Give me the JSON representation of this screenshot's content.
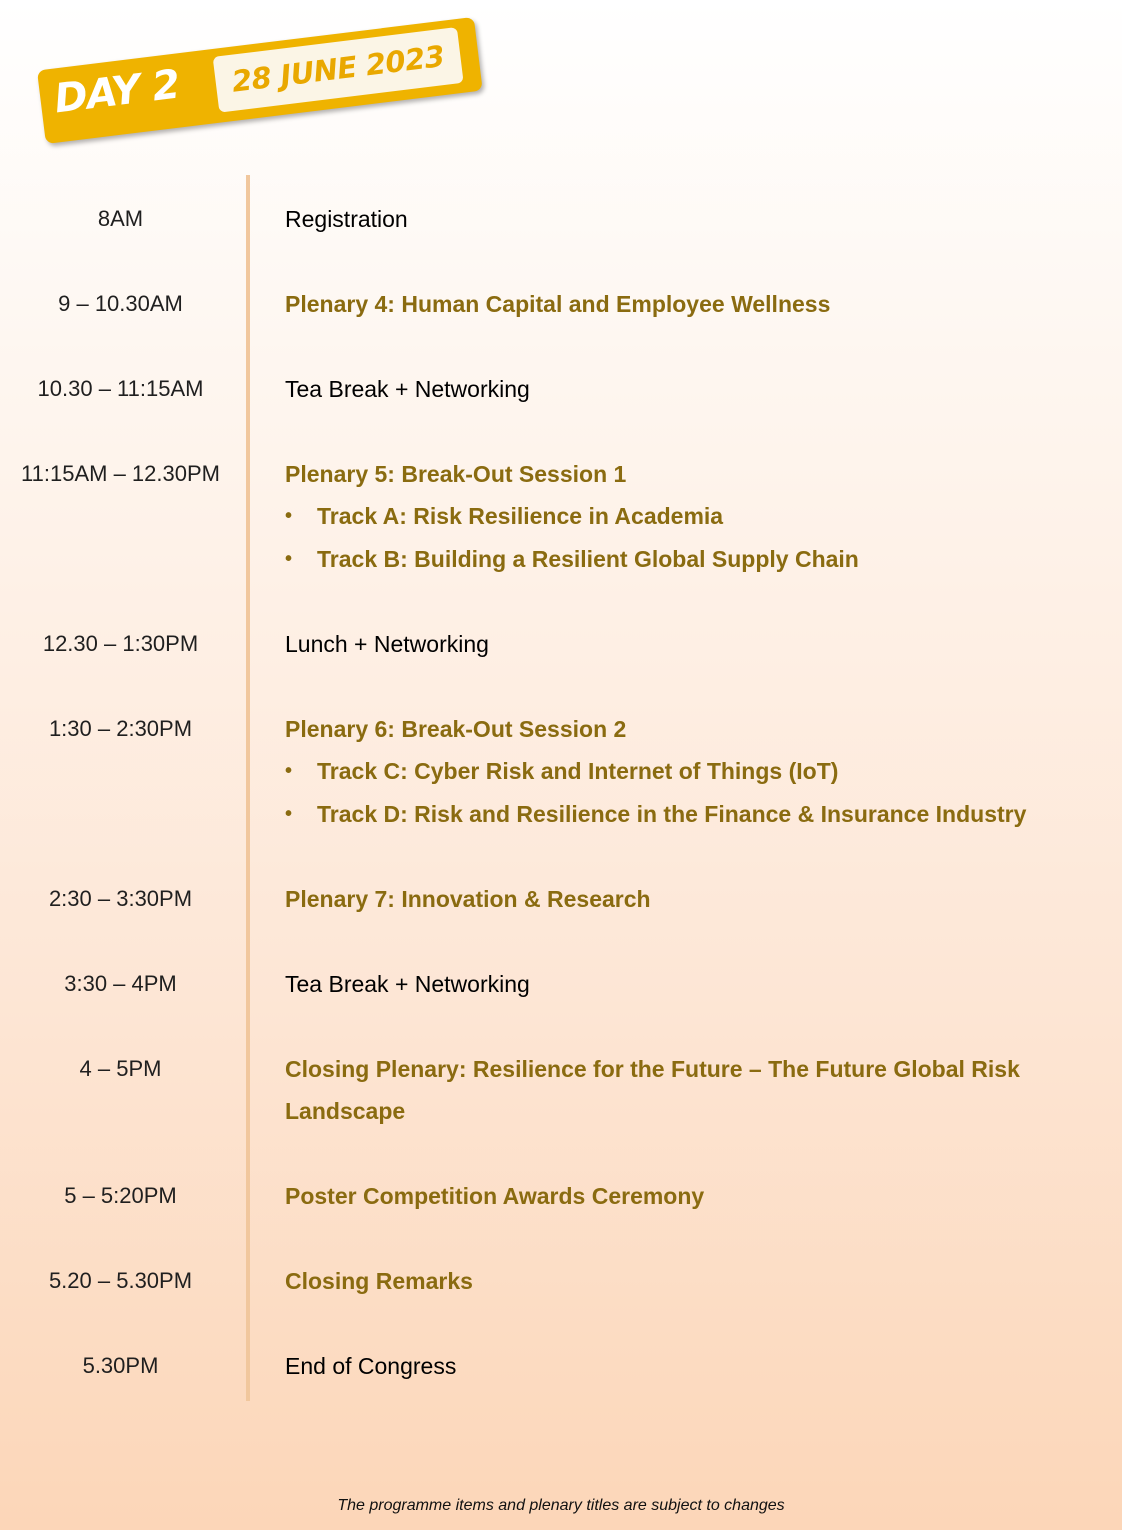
{
  "header": {
    "day": "DAY 2",
    "date": "28 JUNE 2023"
  },
  "agenda": [
    {
      "time": "8AM",
      "title": "Registration"
    },
    {
      "time": "9 – 10.30AM",
      "title": "Plenary 4: Human Capital and Employee Wellness"
    },
    {
      "time": "10.30 – 11:15AM",
      "title": "Tea Break + Networking"
    },
    {
      "time": "11:15AM – 12.30PM",
      "title": "Plenary 5: Break-Out Session 1",
      "tracks": [
        "Track A: Risk Resilience in Academia",
        "Track B: Building a Resilient Global Supply Chain"
      ]
    },
    {
      "time": "12.30 – 1:30PM",
      "title": "Lunch + Networking"
    },
    {
      "time": "1:30 – 2:30PM",
      "title": "Plenary 6: Break-Out Session 2",
      "tracks": [
        "Track C: Cyber Risk and Internet of Things (IoT)",
        "Track D: Risk and Resilience in the Finance & Insurance Industry"
      ]
    },
    {
      "time": "2:30 – 3:30PM",
      "title": "Plenary 7: Innovation & Research"
    },
    {
      "time": "3:30 – 4PM",
      "title": "Tea Break + Networking"
    },
    {
      "time": "4 – 5PM",
      "title": "Closing Plenary: Resilience for the Future – The Future Global Risk Landscape"
    },
    {
      "time": "5 – 5:20PM",
      "title": "Poster Competition Awards Ceremony"
    },
    {
      "time": "5.20 – 5.30PM",
      "title": "Closing Remarks"
    },
    {
      "time": "5.30PM",
      "title": "End of Congress"
    }
  ],
  "footer": "The programme items and plenary titles are subject to changes",
  "colors": {
    "accent_gold": "#8a6b10",
    "banner_yellow": "#efb300",
    "divider": "#f1c79d"
  },
  "icons": {
    "bullet": "•"
  }
}
